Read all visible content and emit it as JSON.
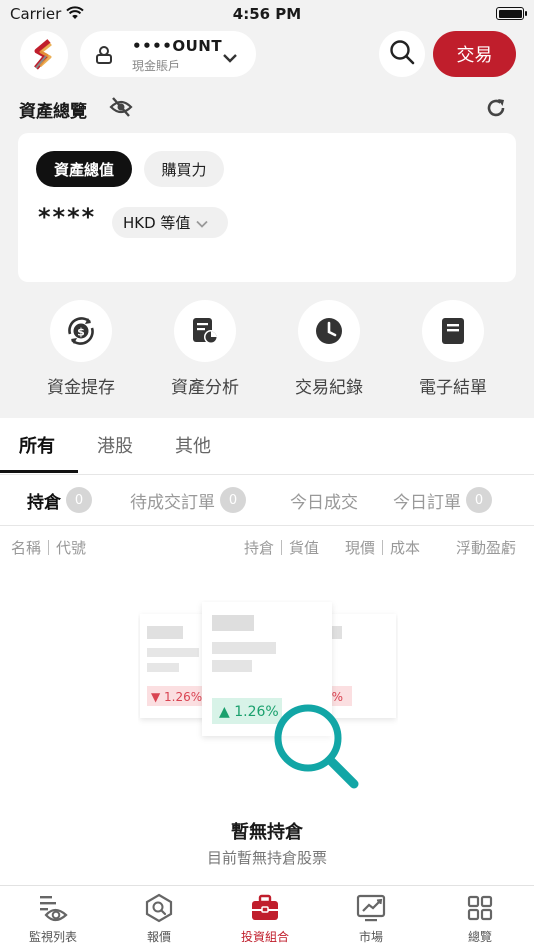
{
  "status_bar": {
    "carrier": "Carrier",
    "time": "4:56 PM"
  },
  "header": {
    "account_name": "••••OUNT",
    "account_type": "現金賬戶",
    "trade_label": "交易"
  },
  "overview": {
    "title": "資產總覽",
    "segment_total": "資產總值",
    "segment_buying_power": "購買力",
    "masked_value": "****",
    "currency": "HKD 等值"
  },
  "quick_actions": [
    {
      "label": "資金提存",
      "icon": "money-transfer-icon"
    },
    {
      "label": "資產分析",
      "icon": "asset-analysis-icon"
    },
    {
      "label": "交易紀錄",
      "icon": "clock-icon"
    },
    {
      "label": "電子結單",
      "icon": "statement-icon"
    }
  ],
  "market_tabs": [
    "所有",
    "港股",
    "其他"
  ],
  "sub_tabs": [
    {
      "label": "持倉",
      "count": "0"
    },
    {
      "label": "待成交訂單",
      "count": "0"
    },
    {
      "label": "今日成交"
    },
    {
      "label": "今日訂單",
      "count": "0"
    }
  ],
  "columns": {
    "name_code": "名稱｜代號",
    "holding_value": "持倉｜貨值",
    "price_cost": "現價｜成本",
    "pnl": "浮動盈虧"
  },
  "empty_state": {
    "title": "暫無持倉",
    "subtitle": "目前暫無持倉股票",
    "card_down": "▼ 1.26%",
    "card_up": "▲ 1.26%",
    "card_right": "6%"
  },
  "bottom_nav": [
    {
      "label": "監視列表"
    },
    {
      "label": "報價"
    },
    {
      "label": "投資組合"
    },
    {
      "label": "市場"
    },
    {
      "label": "總覽"
    }
  ],
  "colors": {
    "brand_red": "#c01e2c",
    "positive_green": "#1aa06d",
    "negative_red": "#d94452",
    "magnifier_teal": "#12a6a6"
  }
}
